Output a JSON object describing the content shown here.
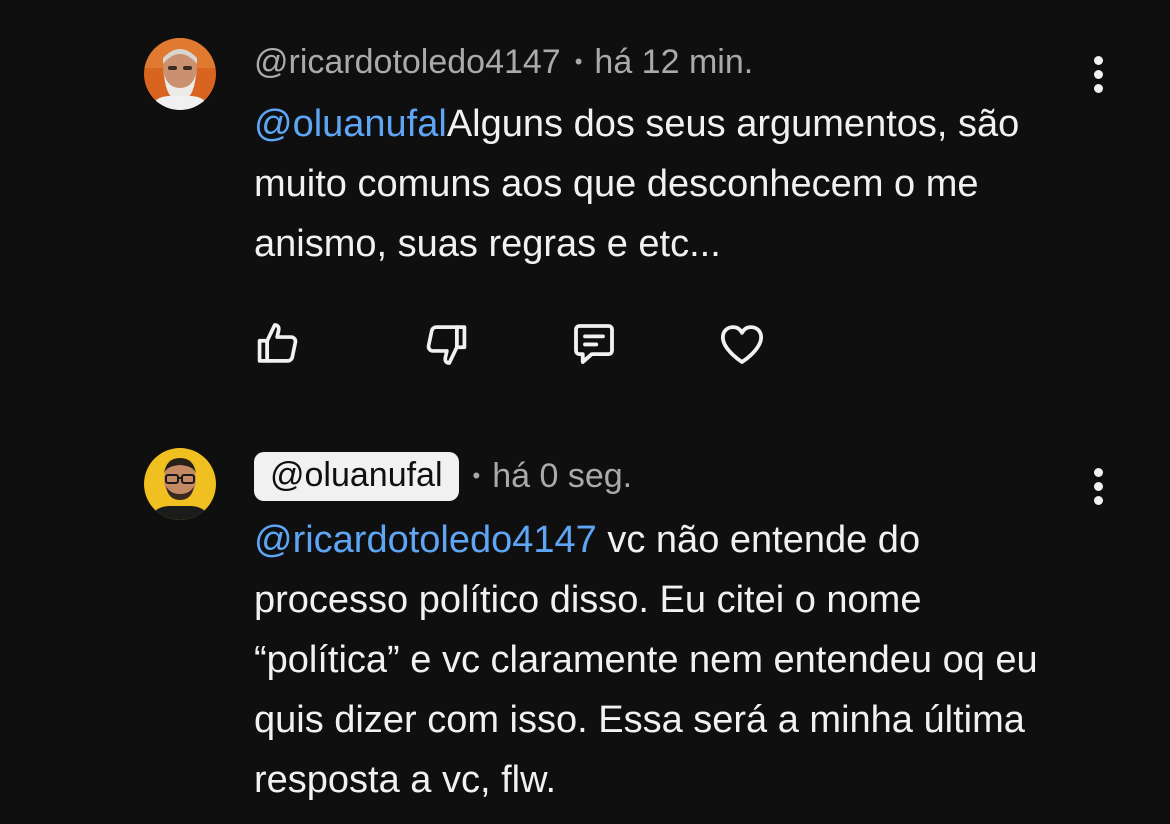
{
  "comments": [
    {
      "author": "@ricardotoledo4147",
      "separator": "•",
      "time": "há 12 min.",
      "mention": "@oluanufal",
      "text": "Alguns dos seus argumentos, são muito comuns aos que desconhecem o me anismo, suas regras e etc...",
      "actions": [
        "like-icon",
        "dislike-icon",
        "reply-icon",
        "heart-icon"
      ],
      "avatar": "avatar-ricardo"
    },
    {
      "author": "@oluanufal",
      "author_highlighted": true,
      "separator": "•",
      "time": "há 0 seg.",
      "mention": "@ricardotoledo4147",
      "text": " vc não entende do processo político disso. Eu citei o nome “política” e vc claramente nem entendeu oq eu quis dizer com isso. Essa será a minha última resposta a vc, flw.",
      "avatar": "avatar-luan"
    }
  ],
  "colors": {
    "background": "#0f0f0f",
    "text": "#f1f1f1",
    "muted": "#aaaaaa",
    "mention": "#5ea6f5",
    "chip_bg": "#f1f1f1"
  },
  "menu_icon": "more-vertical-icon"
}
